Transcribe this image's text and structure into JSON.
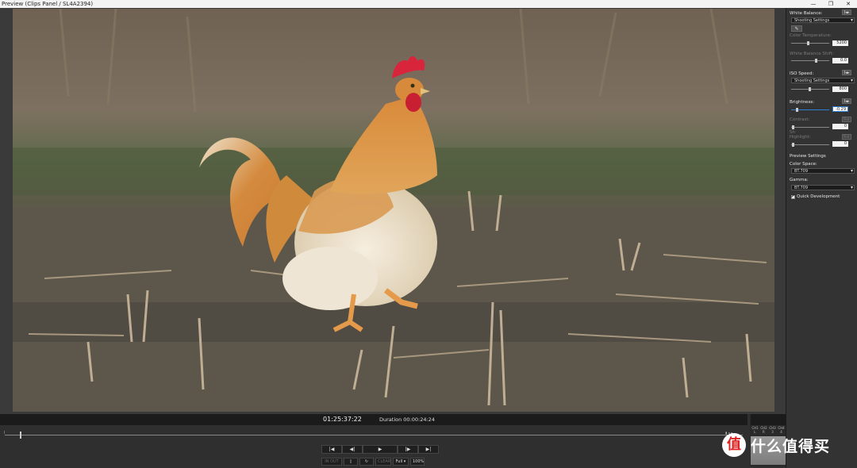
{
  "window": {
    "title": "Preview (Clips Panel / SL4A2394)",
    "minimize": "—",
    "maximize": "❐",
    "close": "✕"
  },
  "panel": {
    "white_balance": {
      "label": "White Balance:",
      "setting": "Shooting Settings",
      "eyedropper": "✎",
      "color_temp_label": "Color Temperature:",
      "color_temp_value": "5200",
      "tint_label": "White Balance Shift:",
      "tint_value": "0.0"
    },
    "iso": {
      "label": "ISO Speed:",
      "setting": "Shooting Settings",
      "value": "800"
    },
    "brightness": {
      "label": "Brightness:",
      "value": "-0.29"
    },
    "contrast": {
      "label": "Contrast:",
      "value": "0"
    },
    "highlight": {
      "label": "Highlight:",
      "value": "0"
    },
    "shadow": {
      "label": "Sh",
      "value": "0"
    },
    "reset_label": "I◂▸",
    "reset_dim": "Rst",
    "preview_settings": {
      "label": "Preview Settings",
      "color_space_label": "Color Space:",
      "color_space": "BT.709",
      "gamma_label": "Gamma:",
      "gamma": "BT.709",
      "quick_dev": "Quick Development"
    }
  },
  "transport": {
    "timecode": "01:25:37:22",
    "duration": "Duration 00:00:24:24",
    "start_marker": "I",
    "buttons": {
      "first": "|◀",
      "prev": "◀|",
      "play": "▶",
      "next": "|▶",
      "last": "▶|"
    },
    "sub_buttons": {
      "mark_in_out": "IN OUT",
      "frame": "▯",
      "loop": "↻",
      "clear": "CLEAR",
      "zoom": "Full ▾",
      "scale": "100%"
    }
  },
  "meter": {
    "head_labels": [
      "CH1",
      "CH2",
      "CH3",
      "CH4"
    ],
    "sub_labels": [
      "L",
      "R",
      "3",
      "4"
    ],
    "mini": "▮ ◂ ◂"
  },
  "watermark": {
    "logo": "值",
    "text": "什么值得买"
  }
}
